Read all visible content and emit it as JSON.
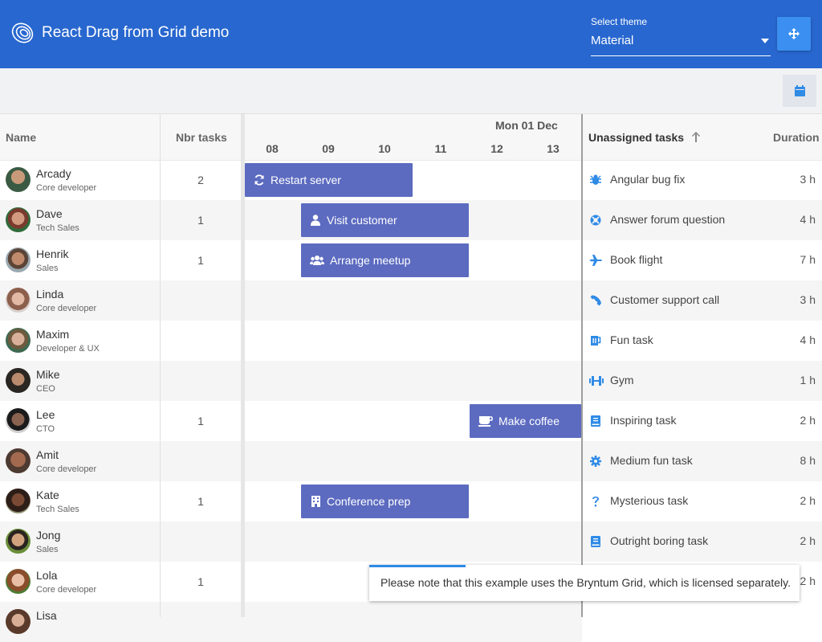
{
  "header": {
    "title": "React Drag from Grid demo",
    "theme_label": "Select theme",
    "theme_value": "Material",
    "logo_icon": "bryntum-logo-icon",
    "fullscreen_icon": "move-arrows-icon"
  },
  "toolbar": {
    "calendar_icon": "calendar-icon"
  },
  "grid": {
    "columns": {
      "name": "Name",
      "nbr_tasks": "Nbr tasks"
    },
    "people": [
      {
        "name": "Arcady",
        "role": "Core developer",
        "tasks": "2"
      },
      {
        "name": "Dave",
        "role": "Tech Sales",
        "tasks": "1"
      },
      {
        "name": "Henrik",
        "role": "Sales",
        "tasks": "1"
      },
      {
        "name": "Linda",
        "role": "Core developer",
        "tasks": ""
      },
      {
        "name": "Maxim",
        "role": "Developer & UX",
        "tasks": ""
      },
      {
        "name": "Mike",
        "role": "CEO",
        "tasks": ""
      },
      {
        "name": "Lee",
        "role": "CTO",
        "tasks": "1"
      },
      {
        "name": "Amit",
        "role": "Core developer",
        "tasks": ""
      },
      {
        "name": "Kate",
        "role": "Tech Sales",
        "tasks": "1"
      },
      {
        "name": "Jong",
        "role": "Sales",
        "tasks": ""
      },
      {
        "name": "Lola",
        "role": "Core developer",
        "tasks": "1"
      },
      {
        "name": "Lisa",
        "role": "",
        "tasks": ""
      }
    ]
  },
  "scheduler": {
    "date": "Mon 01 Dec",
    "hours": [
      "08",
      "09",
      "10",
      "11",
      "12",
      "13"
    ],
    "events": [
      {
        "name": "Restart server",
        "icon": "refresh-icon"
      },
      {
        "name": "Visit customer",
        "icon": "user-icon"
      },
      {
        "name": "Arrange meetup",
        "icon": "users-icon"
      },
      {
        "name": "Make coffee",
        "icon": "coffee-icon"
      },
      {
        "name": "Conference prep",
        "icon": "building-icon"
      }
    ]
  },
  "unassigned": {
    "title": "Unassigned tasks",
    "duration_header": "Duration",
    "sort_icon": "arrow-up-icon",
    "tasks": [
      {
        "name": "Angular bug fix",
        "duration": "3 h",
        "icon": "bug-icon"
      },
      {
        "name": "Answer forum question",
        "duration": "4 h",
        "icon": "lifebuoy-icon"
      },
      {
        "name": "Book flight",
        "duration": "7 h",
        "icon": "plane-icon"
      },
      {
        "name": "Customer support call",
        "duration": "3 h",
        "icon": "phone-icon"
      },
      {
        "name": "Fun task",
        "duration": "4 h",
        "icon": "beer-icon"
      },
      {
        "name": "Gym",
        "duration": "1 h",
        "icon": "dumbbell-icon"
      },
      {
        "name": "Inspiring task",
        "duration": "2 h",
        "icon": "book-icon"
      },
      {
        "name": "Medium fun task",
        "duration": "8 h",
        "icon": "cog-icon"
      },
      {
        "name": "Mysterious task",
        "duration": "2 h",
        "icon": "question-icon"
      },
      {
        "name": "Outright boring task",
        "duration": "2 h",
        "icon": "book-icon"
      },
      {
        "name": "",
        "duration": "2 h",
        "icon": ""
      }
    ]
  },
  "toast": {
    "message": "Please note that this example uses the Bryntum Grid, which is licensed separately."
  },
  "colors": {
    "header": "#2867cf",
    "event": "#5c6bc0",
    "accent": "#3a8ff0"
  }
}
